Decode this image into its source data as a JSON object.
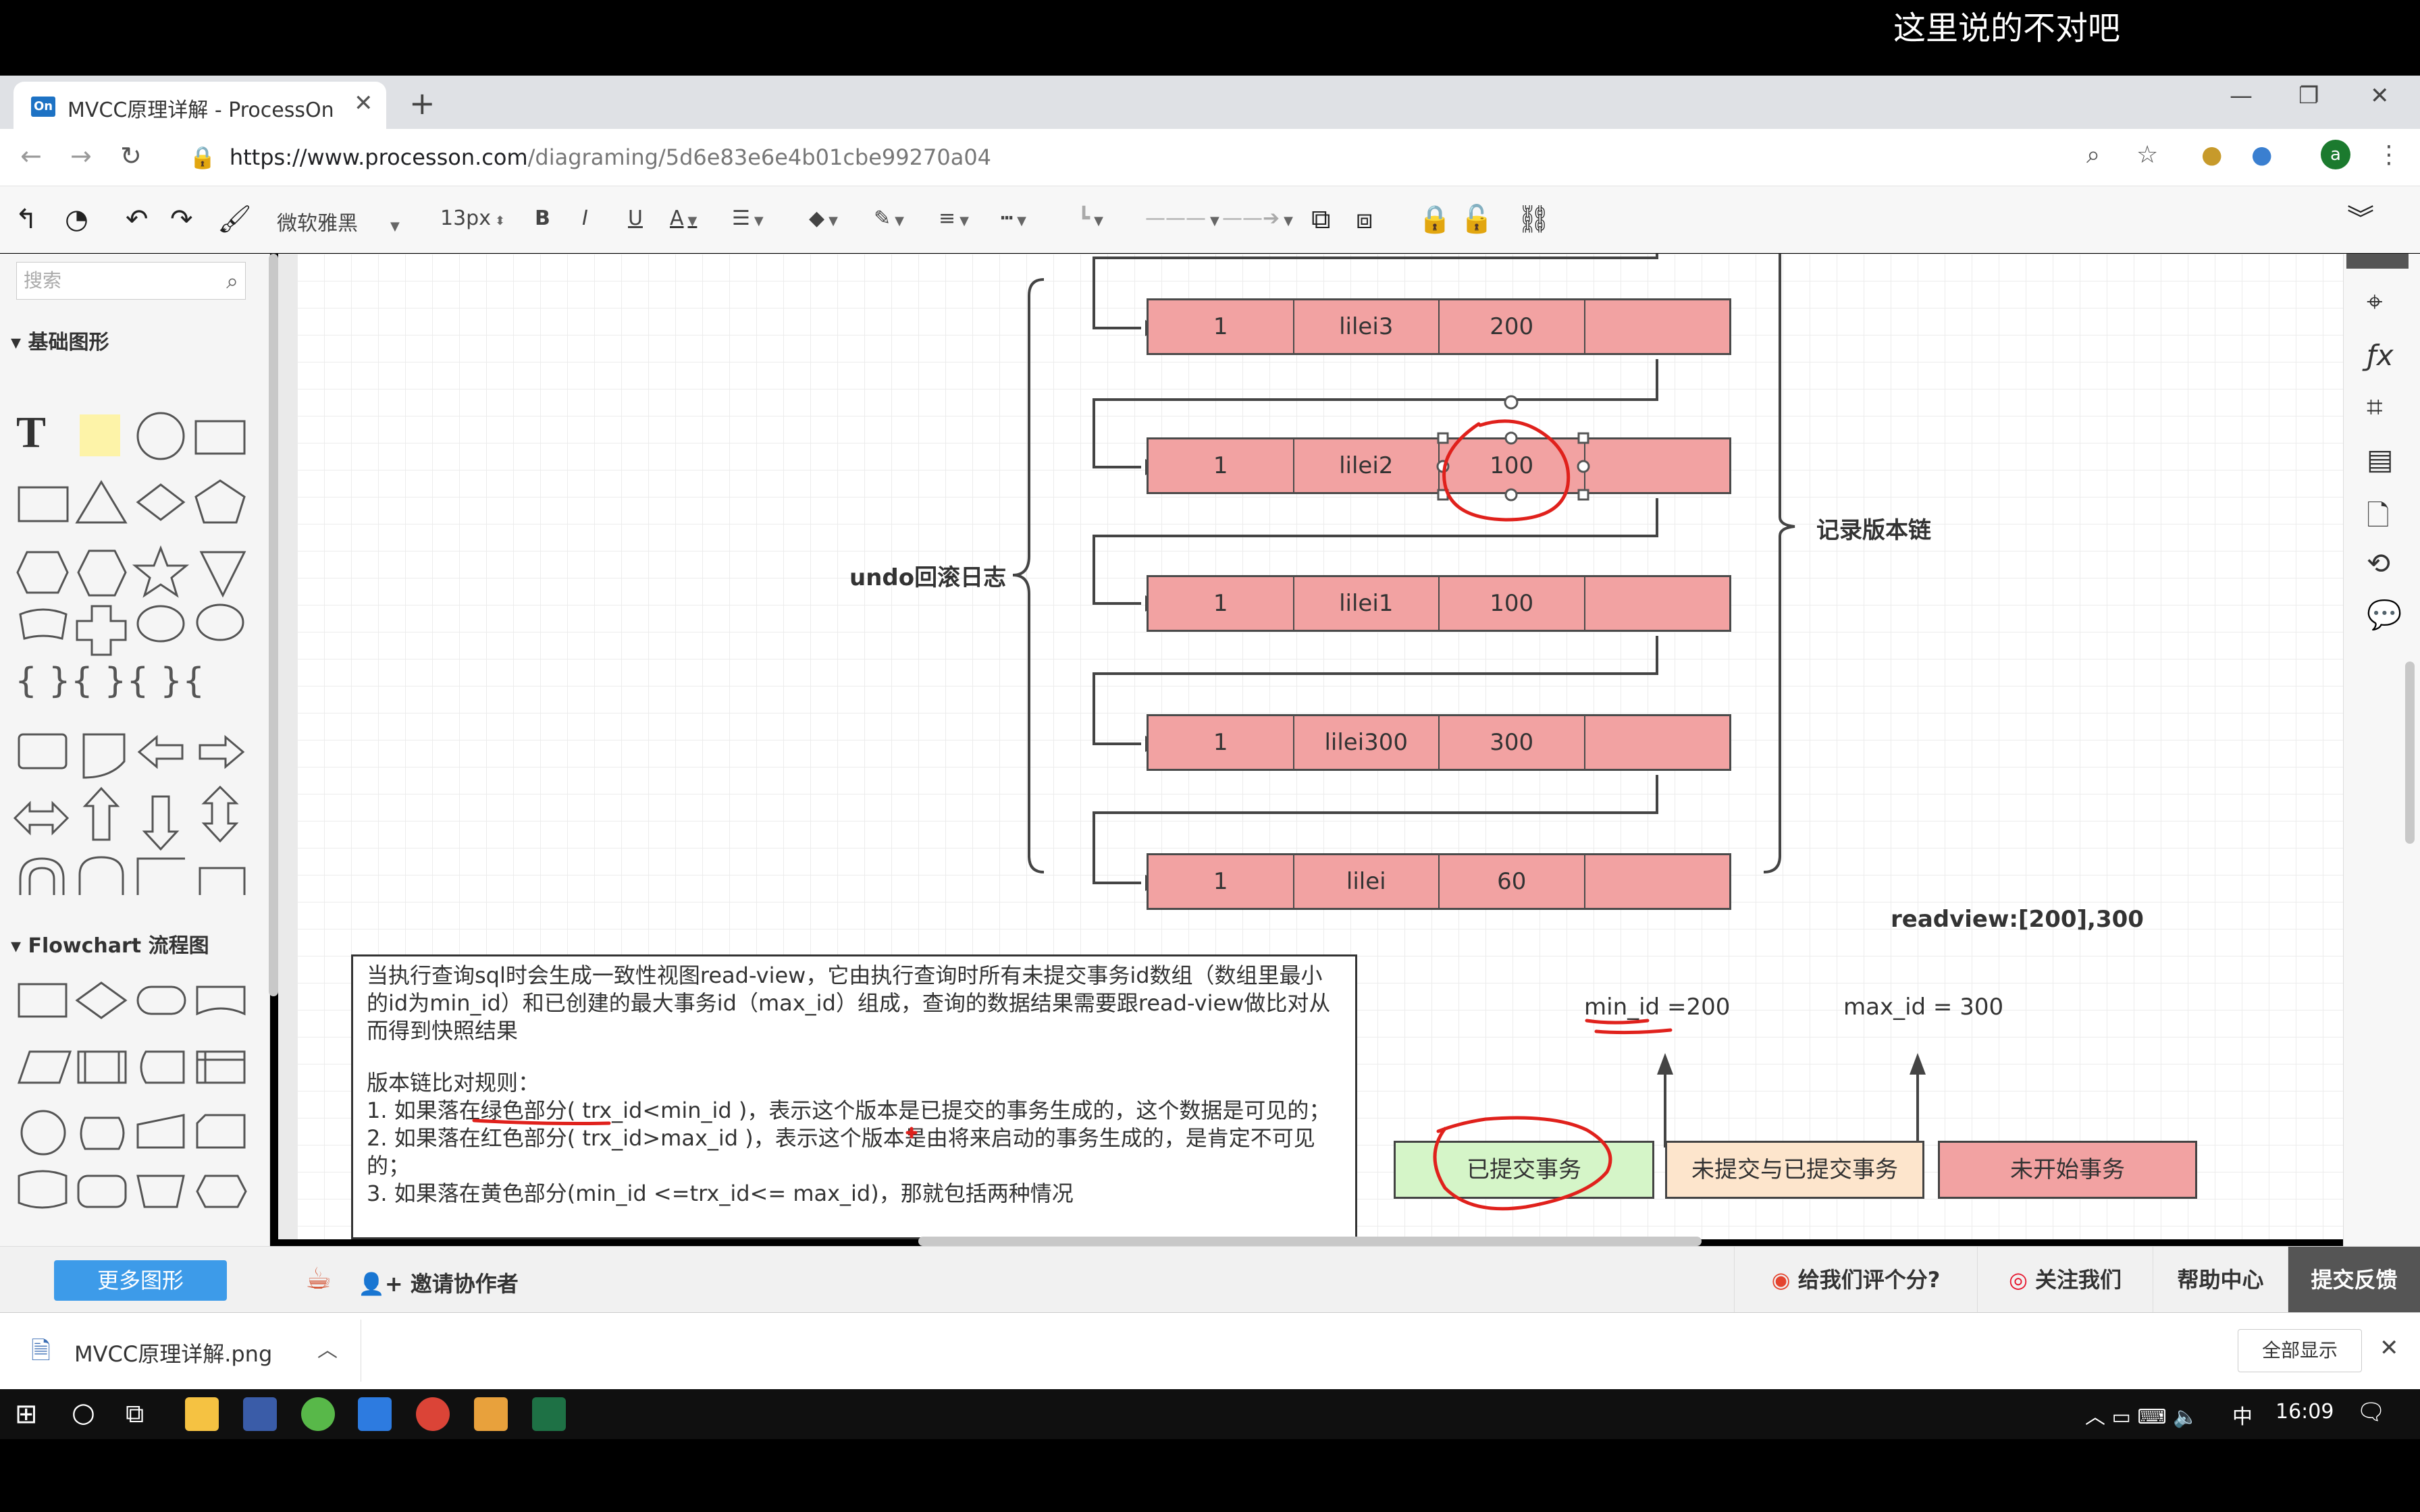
{
  "subtitle": "这里说的不对吧",
  "tab": {
    "title": "MVCC原理详解 - ProcessOn",
    "favicon": "On"
  },
  "url": {
    "host": "https://www.processon.com",
    "path": "/diagraming/5d6e83e6e4b01cbe99270a04"
  },
  "profile_initial": "a",
  "toolbar": {
    "font": "微软雅黑",
    "size": "13px",
    "bold": "B",
    "italic": "I",
    "underline": "U",
    "color": "A"
  },
  "left": {
    "search_placeholder": "搜索",
    "section1": "基础图形",
    "section2": "Flowchart 流程图"
  },
  "diagram": {
    "records": [
      {
        "c1": "1",
        "c2": "lilei3",
        "c3": "200"
      },
      {
        "c1": "1",
        "c2": "lilei2",
        "c3": "100"
      },
      {
        "c1": "1",
        "c2": "lilei1",
        "c3": "100"
      },
      {
        "c1": "1",
        "c2": "lilei300",
        "c3": "300"
      },
      {
        "c1": "1",
        "c2": "lilei",
        "c3": "60"
      }
    ],
    "undo_label": "undo回滚日志",
    "chain_label": "记录版本链",
    "readview": "readview:[200],300",
    "min_id": "min_id =200",
    "max_id": "max_id = 300",
    "boxes": {
      "committed": "已提交事务",
      "mixed": "未提交与已提交事务",
      "not_started": "未开始事务"
    },
    "colors": {
      "record": "#f2a2a2",
      "committed": "#d5f5c8",
      "mixed": "#fde5cc",
      "not_started": "#f2a2a2",
      "annotation": "#e0211c"
    }
  },
  "textbox": {
    "p1": "当执行查询sql时会生成一致性视图read-view，它由执行查询时所有未提交事务id数组（数组里最小的id为min_id）和已创建的最大事务id（max_id）组成，查询的数据结果需要跟read-view做比对从而得到快照结果",
    "p2": "版本链比对规则：",
    "p3": "1. 如果落在绿色部分( trx_id<min_id )，表示这个版本是已提交的事务生成的，这个数据是可见的；",
    "p4": "2. 如果落在红色部分( trx_id>max_id )，表示这个版本是由将来启动的事务生成的，是肯定不可见的；",
    "p5": "3. 如果落在黄色部分(min_id <=trx_id<= max_id)，那就包括两种情况"
  },
  "bottom": {
    "more_shapes": "更多图形",
    "invite": "邀请协作者",
    "rate": "给我们评个分?",
    "follow": "关注我们",
    "help": "帮助中心",
    "feedback": "提交反馈"
  },
  "downloads": {
    "file": "MVCC原理详解.png",
    "show_all": "全部显示"
  },
  "taskbar": {
    "ime": "中",
    "time": "16:09"
  }
}
